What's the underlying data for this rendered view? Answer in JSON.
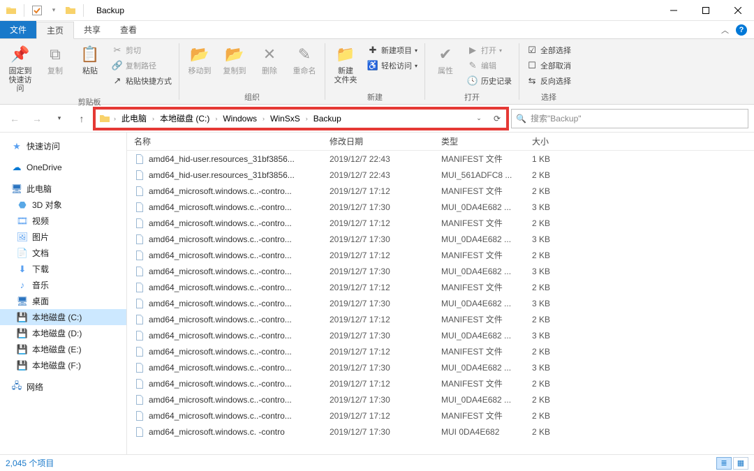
{
  "window": {
    "title": "Backup"
  },
  "tabs": {
    "file": "文件",
    "home": "主页",
    "share": "共享",
    "view": "查看"
  },
  "ribbon": {
    "clipboard": {
      "label": "剪贴板",
      "pin": "固定到\n快速访问",
      "copy": "复制",
      "paste": "粘贴",
      "cut": "剪切",
      "copy_path": "复制路径",
      "paste_shortcut": "粘贴快捷方式"
    },
    "organize": {
      "label": "组织",
      "move_to": "移动到",
      "copy_to": "复制到",
      "delete": "删除",
      "rename": "重命名"
    },
    "new": {
      "label": "新建",
      "new_folder": "新建\n文件夹",
      "new_item": "新建项目",
      "easy_access": "轻松访问"
    },
    "open": {
      "label": "打开",
      "properties": "属性",
      "open": "打开",
      "edit": "编辑",
      "history": "历史记录"
    },
    "select": {
      "label": "选择",
      "select_all": "全部选择",
      "select_none": "全部取消",
      "invert": "反向选择"
    }
  },
  "breadcrumb": [
    "此电脑",
    "本地磁盘 (C:)",
    "Windows",
    "WinSxS",
    "Backup"
  ],
  "search": {
    "placeholder": "搜索\"Backup\""
  },
  "sidebar": {
    "quick_access": "快速访问",
    "onedrive": "OneDrive",
    "this_pc": "此电脑",
    "objects3d": "3D 对象",
    "videos": "视频",
    "pictures": "图片",
    "documents": "文档",
    "downloads": "下载",
    "music": "音乐",
    "desktop": "桌面",
    "disk_c": "本地磁盘 (C:)",
    "disk_d": "本地磁盘 (D:)",
    "disk_e": "本地磁盘 (E:)",
    "disk_f": "本地磁盘 (F:)",
    "network": "网络"
  },
  "columns": {
    "name": "名称",
    "date": "修改日期",
    "type": "类型",
    "size": "大小"
  },
  "files": [
    {
      "name": "amd64_hid-user.resources_31bf3856...",
      "date": "2019/12/7 22:43",
      "type": "MANIFEST 文件",
      "size": "1 KB"
    },
    {
      "name": "amd64_hid-user.resources_31bf3856...",
      "date": "2019/12/7 22:43",
      "type": "MUI_561ADFC8 ...",
      "size": "2 KB"
    },
    {
      "name": "amd64_microsoft.windows.c..-contro...",
      "date": "2019/12/7 17:12",
      "type": "MANIFEST 文件",
      "size": "2 KB"
    },
    {
      "name": "amd64_microsoft.windows.c..-contro...",
      "date": "2019/12/7 17:30",
      "type": "MUI_0DA4E682 ...",
      "size": "3 KB"
    },
    {
      "name": "amd64_microsoft.windows.c..-contro...",
      "date": "2019/12/7 17:12",
      "type": "MANIFEST 文件",
      "size": "2 KB"
    },
    {
      "name": "amd64_microsoft.windows.c..-contro...",
      "date": "2019/12/7 17:30",
      "type": "MUI_0DA4E682 ...",
      "size": "3 KB"
    },
    {
      "name": "amd64_microsoft.windows.c..-contro...",
      "date": "2019/12/7 17:12",
      "type": "MANIFEST 文件",
      "size": "2 KB"
    },
    {
      "name": "amd64_microsoft.windows.c..-contro...",
      "date": "2019/12/7 17:30",
      "type": "MUI_0DA4E682 ...",
      "size": "3 KB"
    },
    {
      "name": "amd64_microsoft.windows.c..-contro...",
      "date": "2019/12/7 17:12",
      "type": "MANIFEST 文件",
      "size": "2 KB"
    },
    {
      "name": "amd64_microsoft.windows.c..-contro...",
      "date": "2019/12/7 17:30",
      "type": "MUI_0DA4E682 ...",
      "size": "3 KB"
    },
    {
      "name": "amd64_microsoft.windows.c..-contro...",
      "date": "2019/12/7 17:12",
      "type": "MANIFEST 文件",
      "size": "2 KB"
    },
    {
      "name": "amd64_microsoft.windows.c..-contro...",
      "date": "2019/12/7 17:30",
      "type": "MUI_0DA4E682 ...",
      "size": "3 KB"
    },
    {
      "name": "amd64_microsoft.windows.c..-contro...",
      "date": "2019/12/7 17:12",
      "type": "MANIFEST 文件",
      "size": "2 KB"
    },
    {
      "name": "amd64_microsoft.windows.c..-contro...",
      "date": "2019/12/7 17:30",
      "type": "MUI_0DA4E682 ...",
      "size": "3 KB"
    },
    {
      "name": "amd64_microsoft.windows.c..-contro...",
      "date": "2019/12/7 17:12",
      "type": "MANIFEST 文件",
      "size": "2 KB"
    },
    {
      "name": "amd64_microsoft.windows.c..-contro...",
      "date": "2019/12/7 17:30",
      "type": "MUI_0DA4E682 ...",
      "size": "2 KB"
    },
    {
      "name": "amd64_microsoft.windows.c..-contro...",
      "date": "2019/12/7 17:12",
      "type": "MANIFEST 文件",
      "size": "2 KB"
    },
    {
      "name": "amd64_microsoft.windows.c. -contro",
      "date": "2019/12/7 17:30",
      "type": "MUI 0DA4E682",
      "size": "2 KB"
    }
  ],
  "status": {
    "count": "2,045 个项目"
  }
}
